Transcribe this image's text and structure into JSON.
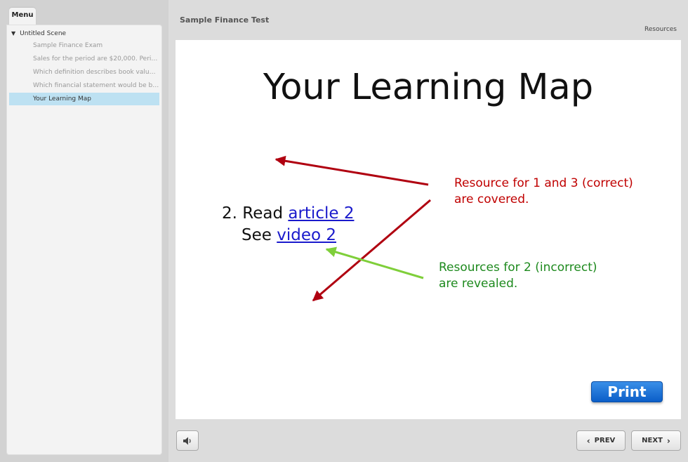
{
  "menu": {
    "tab_label": "Menu",
    "scene_label": "Untitled Scene",
    "items": [
      {
        "label": "Sample Finance Exam"
      },
      {
        "label": "Sales for the period are $20,000. Period ..."
      },
      {
        "label": "Which definition describes book value o..."
      },
      {
        "label": "Which financial statement would be bes..."
      },
      {
        "label": "Your Learning Map",
        "selected": true
      }
    ]
  },
  "header": {
    "title": "Sample Finance Test",
    "resources_label": "Resources"
  },
  "slide": {
    "title": "Your Learning Map",
    "line1_prefix": "2. Read ",
    "line1_link": "article 2",
    "line2_prefix": "See ",
    "line2_link": "video 2",
    "note_red_line1": "Resource for 1 and 3 (correct)",
    "note_red_line2": "are covered.",
    "note_green_line1": "Resources for 2 (incorrect)",
    "note_green_line2": "are revealed.",
    "print_label": "Print",
    "colors": {
      "red_note": "#c00000",
      "green_note": "#1e8a1e",
      "link": "#1a1acc",
      "print_button": "#1a6fd8"
    }
  },
  "controls": {
    "volume_icon": "speaker-icon",
    "prev_label": "PREV",
    "next_label": "NEXT"
  }
}
